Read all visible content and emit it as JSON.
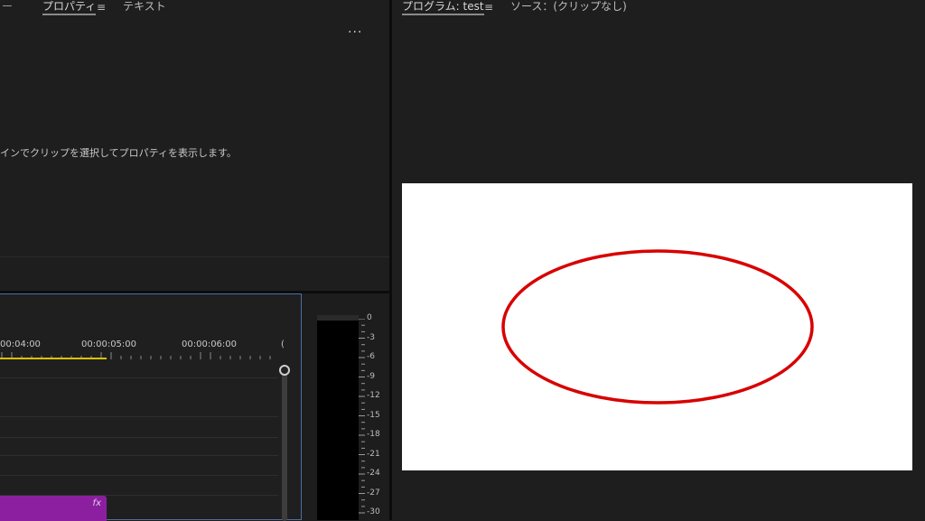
{
  "properties_panel": {
    "tab_left_dash": "ー",
    "tab_properties": "プロパティ",
    "tab_menu": "≡",
    "tab_text": "テキスト",
    "more_menu": "···",
    "empty_message": "インでクリップを選択してプロパティを表示します。"
  },
  "program_panel": {
    "tab_program": "プログラム: test",
    "tab_menu": "≡",
    "tab_source": "ソース：(クリップなし)"
  },
  "timeline": {
    "timecodes": [
      "00:04:00",
      "00:00:05:00",
      "00:00:06:00",
      "("
    ],
    "clip_fx": "fx"
  },
  "audio_meter": {
    "db_scale": [
      "0",
      "-3",
      "-6",
      "-9",
      "-12",
      "-15",
      "-18",
      "-21",
      "-24",
      "-27",
      "-30"
    ]
  },
  "colors": {
    "ellipse_stroke": "#d80000",
    "clip": "#8b1fa0",
    "work_area": "#d9c100",
    "timeline_border": "#4d6ea8"
  }
}
